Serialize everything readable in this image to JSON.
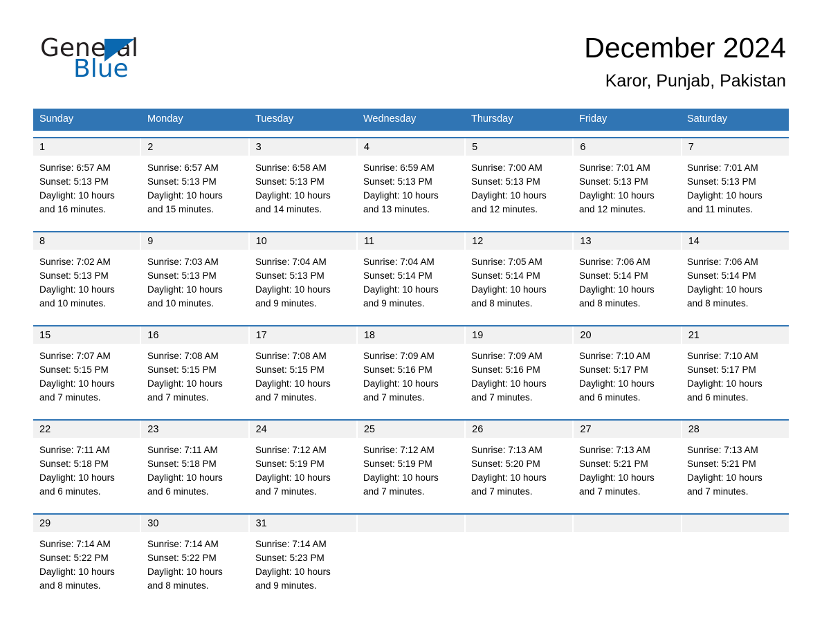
{
  "brand": {
    "name_part1": "General",
    "name_part2": "Blue",
    "accent_color": "#0a68b0"
  },
  "header": {
    "title": "December 2024",
    "location": "Karor, Punjab, Pakistan"
  },
  "calendar": {
    "header_bg": "#3075b4",
    "date_band_bg": "#f1f1f1",
    "weekdays": [
      "Sunday",
      "Monday",
      "Tuesday",
      "Wednesday",
      "Thursday",
      "Friday",
      "Saturday"
    ],
    "weeks": [
      {
        "days": [
          {
            "date": "1",
            "sunrise": "Sunrise: 6:57 AM",
            "sunset": "Sunset: 5:13 PM",
            "daylight_line1": "Daylight: 10 hours",
            "daylight_line2": "and 16 minutes."
          },
          {
            "date": "2",
            "sunrise": "Sunrise: 6:57 AM",
            "sunset": "Sunset: 5:13 PM",
            "daylight_line1": "Daylight: 10 hours",
            "daylight_line2": "and 15 minutes."
          },
          {
            "date": "3",
            "sunrise": "Sunrise: 6:58 AM",
            "sunset": "Sunset: 5:13 PM",
            "daylight_line1": "Daylight: 10 hours",
            "daylight_line2": "and 14 minutes."
          },
          {
            "date": "4",
            "sunrise": "Sunrise: 6:59 AM",
            "sunset": "Sunset: 5:13 PM",
            "daylight_line1": "Daylight: 10 hours",
            "daylight_line2": "and 13 minutes."
          },
          {
            "date": "5",
            "sunrise": "Sunrise: 7:00 AM",
            "sunset": "Sunset: 5:13 PM",
            "daylight_line1": "Daylight: 10 hours",
            "daylight_line2": "and 12 minutes."
          },
          {
            "date": "6",
            "sunrise": "Sunrise: 7:01 AM",
            "sunset": "Sunset: 5:13 PM",
            "daylight_line1": "Daylight: 10 hours",
            "daylight_line2": "and 12 minutes."
          },
          {
            "date": "7",
            "sunrise": "Sunrise: 7:01 AM",
            "sunset": "Sunset: 5:13 PM",
            "daylight_line1": "Daylight: 10 hours",
            "daylight_line2": "and 11 minutes."
          }
        ]
      },
      {
        "days": [
          {
            "date": "8",
            "sunrise": "Sunrise: 7:02 AM",
            "sunset": "Sunset: 5:13 PM",
            "daylight_line1": "Daylight: 10 hours",
            "daylight_line2": "and 10 minutes."
          },
          {
            "date": "9",
            "sunrise": "Sunrise: 7:03 AM",
            "sunset": "Sunset: 5:13 PM",
            "daylight_line1": "Daylight: 10 hours",
            "daylight_line2": "and 10 minutes."
          },
          {
            "date": "10",
            "sunrise": "Sunrise: 7:04 AM",
            "sunset": "Sunset: 5:13 PM",
            "daylight_line1": "Daylight: 10 hours",
            "daylight_line2": "and 9 minutes."
          },
          {
            "date": "11",
            "sunrise": "Sunrise: 7:04 AM",
            "sunset": "Sunset: 5:14 PM",
            "daylight_line1": "Daylight: 10 hours",
            "daylight_line2": "and 9 minutes."
          },
          {
            "date": "12",
            "sunrise": "Sunrise: 7:05 AM",
            "sunset": "Sunset: 5:14 PM",
            "daylight_line1": "Daylight: 10 hours",
            "daylight_line2": "and 8 minutes."
          },
          {
            "date": "13",
            "sunrise": "Sunrise: 7:06 AM",
            "sunset": "Sunset: 5:14 PM",
            "daylight_line1": "Daylight: 10 hours",
            "daylight_line2": "and 8 minutes."
          },
          {
            "date": "14",
            "sunrise": "Sunrise: 7:06 AM",
            "sunset": "Sunset: 5:14 PM",
            "daylight_line1": "Daylight: 10 hours",
            "daylight_line2": "and 8 minutes."
          }
        ]
      },
      {
        "days": [
          {
            "date": "15",
            "sunrise": "Sunrise: 7:07 AM",
            "sunset": "Sunset: 5:15 PM",
            "daylight_line1": "Daylight: 10 hours",
            "daylight_line2": "and 7 minutes."
          },
          {
            "date": "16",
            "sunrise": "Sunrise: 7:08 AM",
            "sunset": "Sunset: 5:15 PM",
            "daylight_line1": "Daylight: 10 hours",
            "daylight_line2": "and 7 minutes."
          },
          {
            "date": "17",
            "sunrise": "Sunrise: 7:08 AM",
            "sunset": "Sunset: 5:15 PM",
            "daylight_line1": "Daylight: 10 hours",
            "daylight_line2": "and 7 minutes."
          },
          {
            "date": "18",
            "sunrise": "Sunrise: 7:09 AM",
            "sunset": "Sunset: 5:16 PM",
            "daylight_line1": "Daylight: 10 hours",
            "daylight_line2": "and 7 minutes."
          },
          {
            "date": "19",
            "sunrise": "Sunrise: 7:09 AM",
            "sunset": "Sunset: 5:16 PM",
            "daylight_line1": "Daylight: 10 hours",
            "daylight_line2": "and 7 minutes."
          },
          {
            "date": "20",
            "sunrise": "Sunrise: 7:10 AM",
            "sunset": "Sunset: 5:17 PM",
            "daylight_line1": "Daylight: 10 hours",
            "daylight_line2": "and 6 minutes."
          },
          {
            "date": "21",
            "sunrise": "Sunrise: 7:10 AM",
            "sunset": "Sunset: 5:17 PM",
            "daylight_line1": "Daylight: 10 hours",
            "daylight_line2": "and 6 minutes."
          }
        ]
      },
      {
        "days": [
          {
            "date": "22",
            "sunrise": "Sunrise: 7:11 AM",
            "sunset": "Sunset: 5:18 PM",
            "daylight_line1": "Daylight: 10 hours",
            "daylight_line2": "and 6 minutes."
          },
          {
            "date": "23",
            "sunrise": "Sunrise: 7:11 AM",
            "sunset": "Sunset: 5:18 PM",
            "daylight_line1": "Daylight: 10 hours",
            "daylight_line2": "and 6 minutes."
          },
          {
            "date": "24",
            "sunrise": "Sunrise: 7:12 AM",
            "sunset": "Sunset: 5:19 PM",
            "daylight_line1": "Daylight: 10 hours",
            "daylight_line2": "and 7 minutes."
          },
          {
            "date": "25",
            "sunrise": "Sunrise: 7:12 AM",
            "sunset": "Sunset: 5:19 PM",
            "daylight_line1": "Daylight: 10 hours",
            "daylight_line2": "and 7 minutes."
          },
          {
            "date": "26",
            "sunrise": "Sunrise: 7:13 AM",
            "sunset": "Sunset: 5:20 PM",
            "daylight_line1": "Daylight: 10 hours",
            "daylight_line2": "and 7 minutes."
          },
          {
            "date": "27",
            "sunrise": "Sunrise: 7:13 AM",
            "sunset": "Sunset: 5:21 PM",
            "daylight_line1": "Daylight: 10 hours",
            "daylight_line2": "and 7 minutes."
          },
          {
            "date": "28",
            "sunrise": "Sunrise: 7:13 AM",
            "sunset": "Sunset: 5:21 PM",
            "daylight_line1": "Daylight: 10 hours",
            "daylight_line2": "and 7 minutes."
          }
        ]
      },
      {
        "days": [
          {
            "date": "29",
            "sunrise": "Sunrise: 7:14 AM",
            "sunset": "Sunset: 5:22 PM",
            "daylight_line1": "Daylight: 10 hours",
            "daylight_line2": "and 8 minutes."
          },
          {
            "date": "30",
            "sunrise": "Sunrise: 7:14 AM",
            "sunset": "Sunset: 5:22 PM",
            "daylight_line1": "Daylight: 10 hours",
            "daylight_line2": "and 8 minutes."
          },
          {
            "date": "31",
            "sunrise": "Sunrise: 7:14 AM",
            "sunset": "Sunset: 5:23 PM",
            "daylight_line1": "Daylight: 10 hours",
            "daylight_line2": "and 9 minutes."
          },
          {
            "date": "",
            "sunrise": "",
            "sunset": "",
            "daylight_line1": "",
            "daylight_line2": ""
          },
          {
            "date": "",
            "sunrise": "",
            "sunset": "",
            "daylight_line1": "",
            "daylight_line2": ""
          },
          {
            "date": "",
            "sunrise": "",
            "sunset": "",
            "daylight_line1": "",
            "daylight_line2": ""
          },
          {
            "date": "",
            "sunrise": "",
            "sunset": "",
            "daylight_line1": "",
            "daylight_line2": ""
          }
        ]
      }
    ]
  }
}
